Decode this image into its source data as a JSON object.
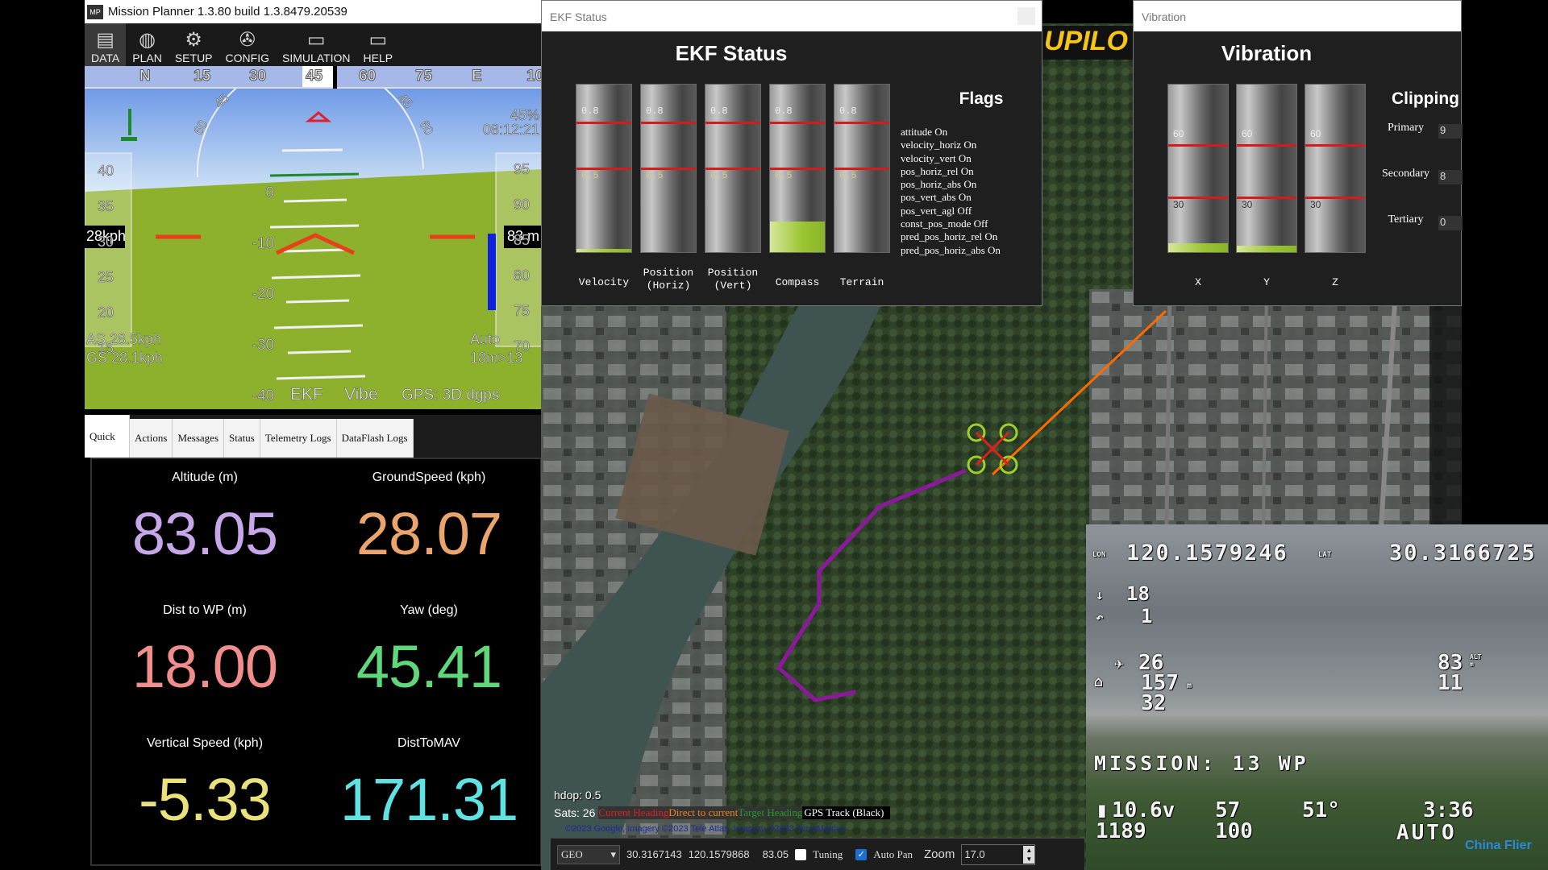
{
  "window": {
    "title": "Mission Planner 1.3.80 build 1.3.8479.20539",
    "logo": "MP"
  },
  "toolbar": [
    {
      "label": "DATA",
      "icon": "data-icon"
    },
    {
      "label": "PLAN",
      "icon": "globe-icon"
    },
    {
      "label": "SETUP",
      "icon": "gear-icon"
    },
    {
      "label": "CONFIG",
      "icon": "wrench-icon"
    },
    {
      "label": "SIMULATION",
      "icon": "monitor-plane-icon"
    },
    {
      "label": "HELP",
      "icon": "monitor-help-icon"
    }
  ],
  "compass": {
    "labels": [
      "N",
      "15",
      "30",
      "45",
      "60",
      "75",
      "E",
      "10"
    ],
    "heading": "45"
  },
  "hud": {
    "battery": "45%",
    "time": "08:12:21",
    "speed_box": "28kph",
    "alt_box": "83 m",
    "airspeed": "AS 28.5kph",
    "groundspeed": "GS 28.1kph",
    "mode": "Auto",
    "wp": "18m>13",
    "ekf": "EKF",
    "vibe": "Vibe",
    "gps": "GPS: 3D dgps",
    "speed_ticks": [
      "40",
      "35",
      "30",
      "25",
      "20",
      "15"
    ],
    "alt_ticks": [
      "95",
      "90",
      "85",
      "80",
      "75",
      "70"
    ],
    "pitch_ticks": [
      "0",
      "-10",
      "-20",
      "-30",
      "-40"
    ],
    "roll_ticks": [
      "60",
      "45",
      "30",
      "20",
      "10",
      "0",
      "10",
      "20",
      "30",
      "45",
      "60"
    ]
  },
  "tabs": [
    "Quick",
    "Actions",
    "Messages",
    "Status",
    "Telemetry Logs",
    "DataFlash Logs"
  ],
  "quick": [
    {
      "label": "Altitude (m)",
      "value": "83.05",
      "color": "#c8a6ea"
    },
    {
      "label": "GroundSpeed (kph)",
      "value": "28.07",
      "color": "#eba46c"
    },
    {
      "label": "Dist to WP (m)",
      "value": "18.00",
      "color": "#f28d8d"
    },
    {
      "label": "Yaw (deg)",
      "value": "45.41",
      "color": "#5fd87c"
    },
    {
      "label": "Vertical Speed (kph)",
      "value": "-5.33",
      "color": "#e9e27c"
    },
    {
      "label": "DistToMAV",
      "value": "171.31",
      "color": "#5fe2e2"
    }
  ],
  "ekf": {
    "window_title": "EKF Status",
    "title": "EKF Status",
    "tick_high": "0.8",
    "tick_low": "0.5",
    "bars": [
      {
        "label": "Velocity",
        "value": 0.02
      },
      {
        "label": "Position\n(Horiz)",
        "value": 0
      },
      {
        "label": "Position\n(Vert)",
        "value": 0
      },
      {
        "label": "Compass",
        "value": 0.18
      },
      {
        "label": "Terrain",
        "value": 0
      }
    ],
    "flags_title": "Flags",
    "flags": [
      "attitude On",
      "velocity_horiz On",
      "velocity_vert On",
      "pos_horiz_rel On",
      "pos_horiz_abs On",
      "pos_vert_abs On",
      "pos_vert_agl Off",
      "const_pos_mode Off",
      "pred_pos_horiz_rel On",
      "pred_pos_horiz_abs On"
    ]
  },
  "vibration": {
    "window_title": "Vibration",
    "title": "Vibration",
    "tick_high": "60",
    "tick_low": "30",
    "bars": [
      {
        "label": "X",
        "value": 6
      },
      {
        "label": "Y",
        "value": 4
      },
      {
        "label": "Z",
        "value": 0
      }
    ],
    "clipping_title": "Clipping",
    "clipping": [
      {
        "label": "Primary",
        "value": "9"
      },
      {
        "label": "Secondary",
        "value": "8"
      },
      {
        "label": "Tertiary",
        "value": "0"
      }
    ]
  },
  "banner": "UPILO",
  "map": {
    "hdop": "hdop: 0.5",
    "sats": "Sats: 26",
    "legend": [
      {
        "text": "Current Heading",
        "color": "#e02020"
      },
      {
        "text": "Direct to current",
        "color": "#f08020"
      },
      {
        "text": "Target Heading",
        "color": "#20a020"
      },
      {
        "text": "GPS Track (Black)",
        "color": "#ffffff"
      }
    ],
    "copyright": "©2023 Google, Imagery ©2023 Tele Atlas, Imagery ©2023 TerraMetrics",
    "track_color": "#8b1a9b"
  },
  "statusbar": {
    "coord_system": "GEO",
    "lat": "30.3167143",
    "lon": "120.1579868",
    "alt": "83.05",
    "tuning": "Tuning",
    "tuning_checked": false,
    "autopan": "Auto Pan",
    "autopan_checked": true,
    "zoom_label": "Zoom",
    "zoom": "17.0"
  },
  "osd": {
    "lon_label": "LON",
    "lon": "120.1579246",
    "lat_label": "LAT",
    "lat": "30.3166725",
    "pitch": "18",
    "roll": "1",
    "sats": "26",
    "home_dist": "157",
    "home_unit": "m",
    "speed": "32",
    "alt": "83",
    "alt_unit": "ALT m",
    "throttle": "11",
    "mission": "MISSION: 13 WP",
    "voltage": "10.6v",
    "rssi": "57",
    "heading": "51°",
    "distance": "1189",
    "dist_unit": "m",
    "lq": "100",
    "flytime": "3:36",
    "mode": "AUTO",
    "watermark": "China Flier"
  }
}
